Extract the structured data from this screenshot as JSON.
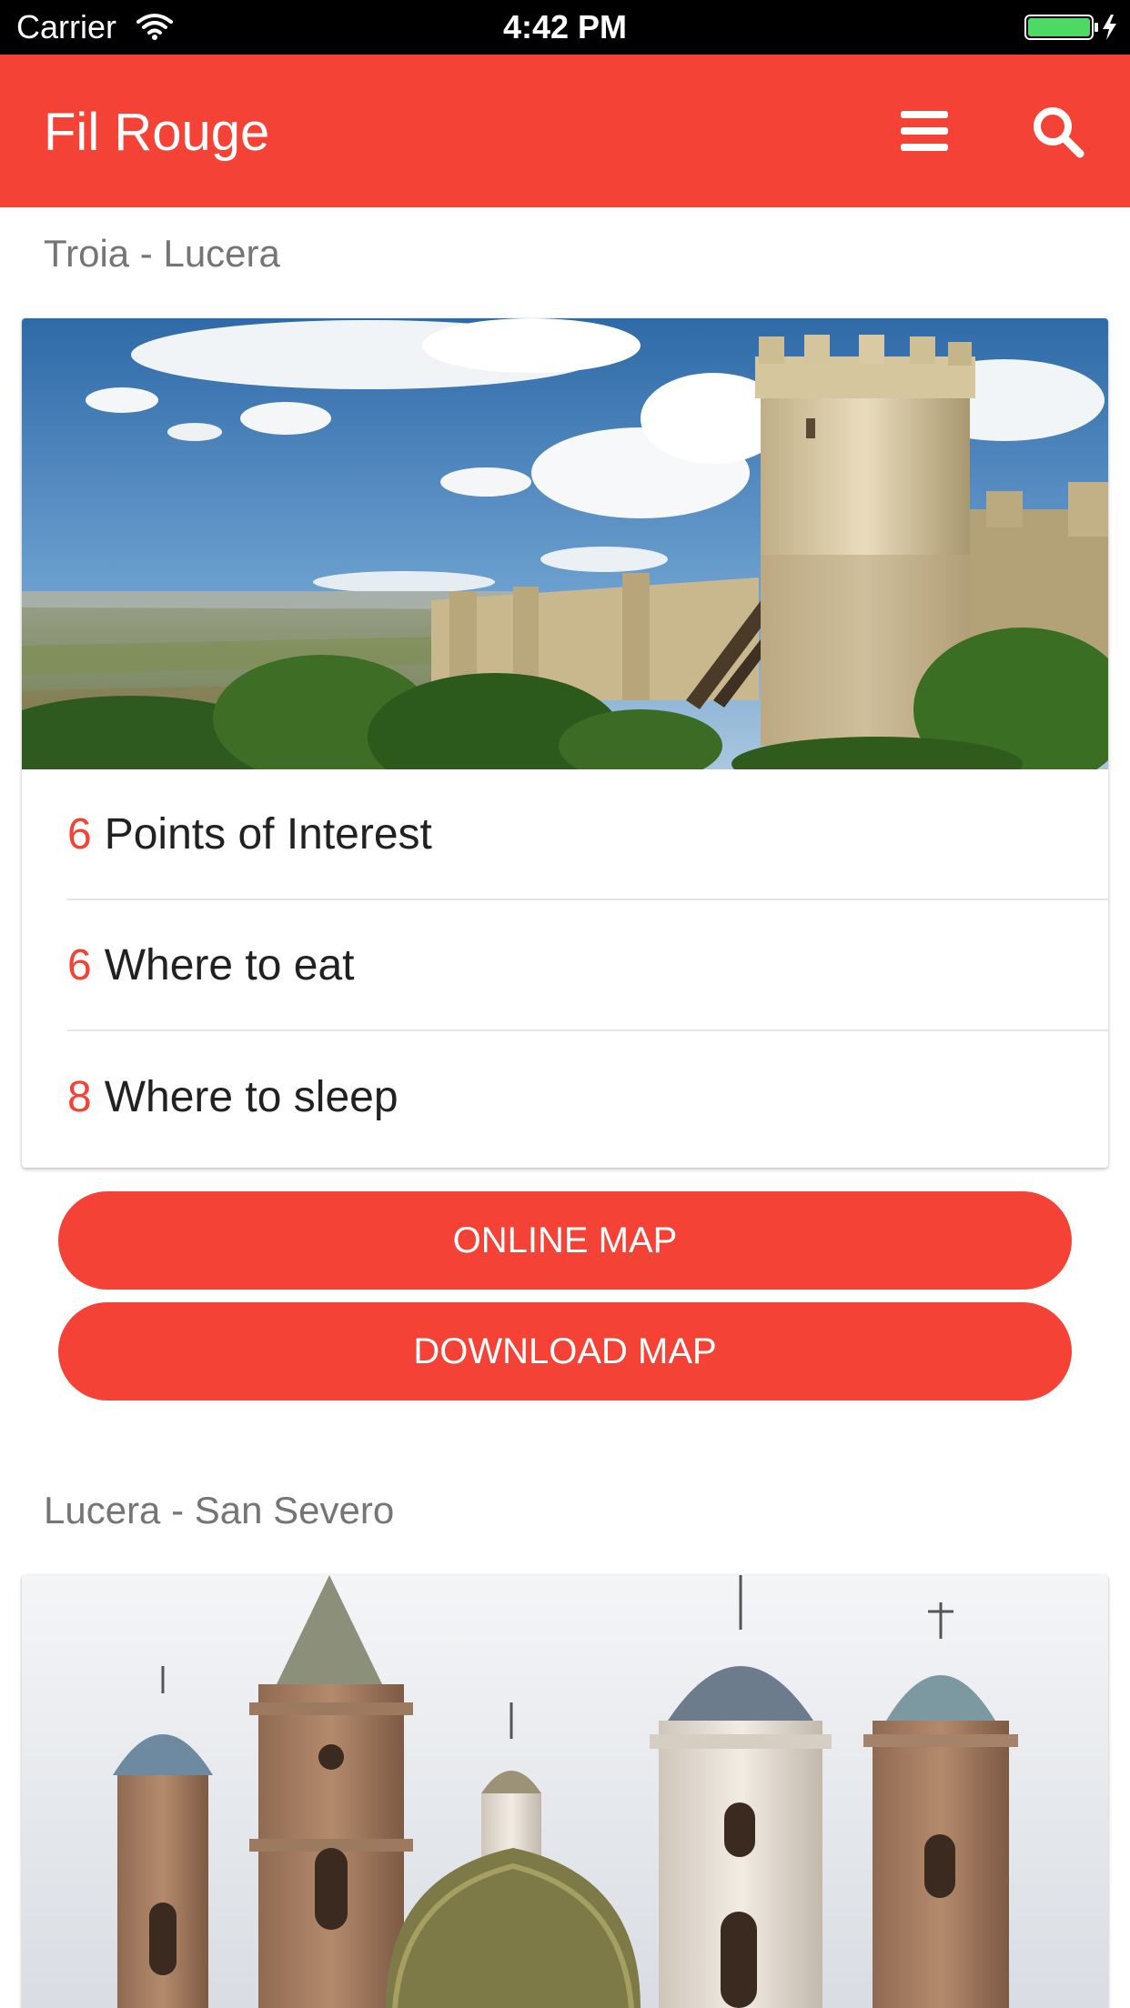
{
  "status_bar": {
    "carrier": "Carrier",
    "time": "4:42 PM",
    "battery_color": "#4cd964"
  },
  "app_bar": {
    "title": "Fil Rouge",
    "menu_icon": "hamburger-menu-icon",
    "search_icon": "search-icon",
    "color": "#f44336"
  },
  "sections": [
    {
      "title": "Troia - Lucera",
      "image": "castle-landscape-photo",
      "rows": [
        {
          "count": "6",
          "label": "Points of Interest"
        },
        {
          "count": "6",
          "label": "Where to eat"
        },
        {
          "count": "8",
          "label": "Where to sleep"
        }
      ],
      "buttons": {
        "online_map": "ONLINE MAP",
        "download_map": "DOWNLOAD MAP"
      }
    },
    {
      "title": "Lucera - San Severo",
      "image": "church-towers-photo"
    }
  ]
}
